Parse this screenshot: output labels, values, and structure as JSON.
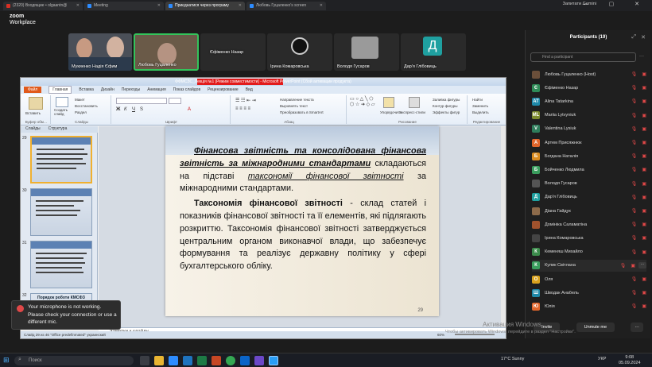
{
  "browser": {
    "tabs": [
      {
        "label": "(2320) Входящие • olgaantn@"
      },
      {
        "label": "Meeting"
      },
      {
        "label": "Приєднатися через програму"
      },
      {
        "label": "Любовь Гуцаленко's screen"
      }
    ],
    "gemini_label": "Запитати Gemini",
    "win_controls": "— ▢ ✕"
  },
  "zoom": {
    "brand": "zoom",
    "brand_sub": "Workplace",
    "video_tiles": [
      {
        "name": "Мукиенко Надія Єфим"
      },
      {
        "name": "Любовь Гуцаленко"
      },
      {
        "name": "Єфіменко Назар"
      },
      {
        "name": "Ірина Комаровська"
      },
      {
        "name": "Володя Гусаров"
      },
      {
        "name": "Дар'я Глібовиць",
        "initial": "Д"
      }
    ]
  },
  "participants": {
    "title": "Participants (19)",
    "search_placeholder": "Find a participant",
    "rows": [
      {
        "name": "Любовь Гуцаленко (Host)",
        "color": "#6b4f3a",
        "initial": ""
      },
      {
        "name": "Єфіменко Назар",
        "color": "#2e8b57",
        "initial": "Є"
      },
      {
        "name": "Alina Tatarkina",
        "color": "#1e88a8",
        "initial": "AT"
      },
      {
        "name": "Mariia Lytvyniuk",
        "color": "#7c8a2e",
        "initial": "ML"
      },
      {
        "name": "Valentina Lysiuk",
        "color": "#2e7d5b",
        "initial": "V"
      },
      {
        "name": "Артем Присяжнюк",
        "color": "#e0652b",
        "initial": "А"
      },
      {
        "name": "Богдана Наталія",
        "color": "#d98a1e",
        "initial": "Б"
      },
      {
        "name": "Бойченко Людмила",
        "color": "#3a9d5d",
        "initial": "Б"
      },
      {
        "name": "Володя Гусаров",
        "color": "#555",
        "initial": ""
      },
      {
        "name": "Дар'я Глібовиць",
        "color": "#1fa0a0",
        "initial": "Д"
      },
      {
        "name": "Діана Гайдук",
        "color": "#8c6a4a",
        "initial": ""
      },
      {
        "name": "Домініка Саламатіна",
        "color": "#a0522d",
        "initial": ""
      },
      {
        "name": "Ірина Комаровська",
        "color": "#444",
        "initial": ""
      },
      {
        "name": "Кеменяш Михайло",
        "color": "#3c8c4c",
        "initial": "К"
      },
      {
        "name": "Кулик Світлана",
        "color": "#3a9d5d",
        "initial": "К"
      },
      {
        "name": "Оля",
        "color": "#d9a21e",
        "initial": "О"
      },
      {
        "name": "Шводак Анабель",
        "color": "#1e88a8",
        "initial": "Ш"
      },
      {
        "name": "Юлія",
        "color": "#e0652b",
        "initial": "Ю"
      }
    ],
    "invite": "Invite",
    "unmute_me": "Unmute me"
  },
  "ppt": {
    "title": "ФФМСЗС_Лекція №1 [Режим совместимости] - Microsoft PowerPoint (Сбой активации продукта)",
    "tabs": [
      "Файл",
      "Главная",
      "Вставка",
      "Дизайн",
      "Переходы",
      "Анимация",
      "Показ слайдов",
      "Рецензирование",
      "Вид"
    ],
    "ribbon": {
      "paste": "Вставить",
      "create_slide": "Создать слайд",
      "layout": "Макет",
      "restore": "Восстановить",
      "section": "Раздел",
      "clipboard": "Буфер обм…",
      "slides": "Слайды",
      "font": "Шрифт",
      "paragraph": "Абзац",
      "text_dir": "Направление текста",
      "align_text": "Выровнять текст",
      "smartart": "Преобразовать в SmartArt",
      "arrange": "Упорядочить",
      "quick_styles": "Экспресс-стили",
      "fill": "Заливка фигуры",
      "outline": "Контур фигуры",
      "effects": "Эффекты фигур",
      "drawing": "Рисование",
      "find": "Найти",
      "replace": "Заменить",
      "select": "Выделить",
      "editing": "Редактирование"
    },
    "panel_tabs": [
      "Слайды",
      "Структура"
    ],
    "thumb_numbers": [
      "29",
      "30",
      "31",
      "32"
    ],
    "thumb_last_label": "Порядок роботи КМСФЗ",
    "slide": {
      "p1_a": "Фінансова звітність та консолідована фінансова звітність за міжнародними стандартами",
      "p1_b": " складаються на підставі ",
      "p1_c": "таксономії фінансової звітності",
      "p1_d": " за міжнародними стандартами.",
      "p2_a": "Таксономія фінансової звітності",
      "p2_b": " - склад статей і показників фінансової звітності та її елементів, які підлягають розкриттю. Таксономія фінансової звітності затверджується центральним органом виконавчої влади, що забезпечує формування та реалізує державну політику у сфері бухгалтерського обліку.",
      "number": "29"
    },
    "notes": "Заметки к слайду",
    "status": "Слайд 29 из 46    \"Office predefinmated\"    украинский",
    "zoom": "60%"
  },
  "toast": {
    "text": "Your microphone is not working. Please check your connection or use a different mic."
  },
  "activate": {
    "line1": "Активация Windows",
    "line2": "Чтобы активировать Windows, перейдите в раздел \"Настройки\"."
  },
  "taskbar": {
    "search": "Поиск",
    "weather": "17°C  Sunny",
    "lang": "УКР",
    "time": "9:08",
    "date": "05.09.2024"
  }
}
